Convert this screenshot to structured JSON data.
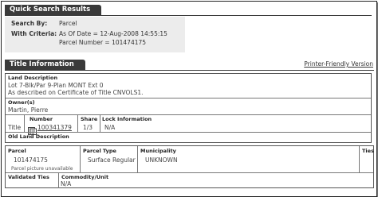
{
  "quick_search": {
    "tab_title": "Quick Search Results",
    "search_by_label": "Search By:",
    "search_by_value": "Parcel",
    "criteria_label": "With Criteria:",
    "criteria_line1": "As Of Date = 12-Aug-2008 14:55:15",
    "criteria_line2": "Parcel Number = 101474175"
  },
  "title_info": {
    "tab_title": "Title Information",
    "printer_link": "Printer-Friendly Version",
    "land_description_label": "Land Description",
    "land_description_line1": "Lot 7-Blk/Par 9-Plan MONT Ext 0",
    "land_description_line2": "As described on Certificate of Title CNVOLS1.",
    "owners_label": "Owner(s)",
    "owner_name": "Martin, Pierre",
    "row_label": "Title",
    "number_label": "Number",
    "number_value": "100341379",
    "share_label": "Share",
    "share_value": "1/3",
    "lock_label": "Lock Information",
    "lock_value": "N/A",
    "old_land_label": "Old Land Description"
  },
  "parcel": {
    "parcel_label": "Parcel",
    "parcel_value": "101474175",
    "picture_note": "Parcel picture unavailable",
    "type_label": "Parcel Type",
    "type_value": "Surface Regular",
    "municipality_label": "Municipality",
    "municipality_value": "UNKNOWN",
    "ties_label": "Ties",
    "validated_ties_label": "Validated Ties",
    "commodity_label": "Commodity/Unit",
    "commodity_value": "N/A"
  },
  "colors": {
    "tab_bg": "#3a3a3a",
    "search_box_bg": "#ececec"
  }
}
